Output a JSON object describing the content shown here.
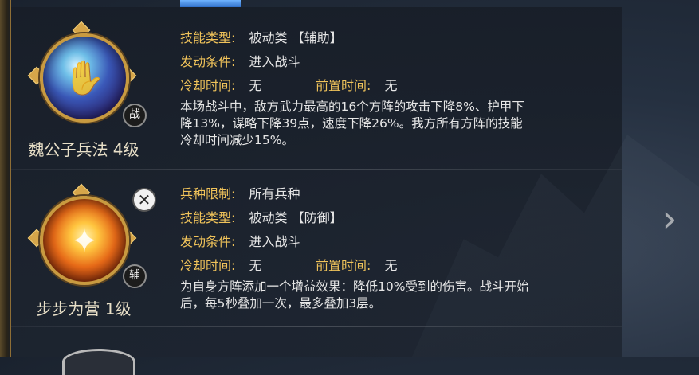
{
  "skills": [
    {
      "name": "魏公子兵法 4级",
      "badge": "战",
      "icon": "blue-spell-orb-icon",
      "rows": [
        {
          "label": "技能类型:",
          "value": "被动类 【辅助】"
        },
        {
          "label": "发动条件:",
          "value": "进入战斗"
        }
      ],
      "cooldown": {
        "label": "冷却时间:",
        "value": "无"
      },
      "prep": {
        "label": "前置时间:",
        "value": "无"
      },
      "description_lines": [
        "本场战斗中，敌方武力最高的16个方阵的攻击下降8%、护甲下",
        "降13%，谋略下降39点，速度下降26%。我方所有方阵的技能",
        "冷却时间减少15%。"
      ]
    },
    {
      "name": "步步为营 1级",
      "badge": "辅",
      "icon": "golden-shield-orb-icon",
      "close_label": "✕",
      "rows": [
        {
          "label": "兵种限制:",
          "value": "所有兵种"
        },
        {
          "label": "技能类型:",
          "value": "被动类 【防御】"
        },
        {
          "label": "发动条件:",
          "value": "进入战斗"
        }
      ],
      "cooldown": {
        "label": "冷却时间:",
        "value": "无"
      },
      "prep": {
        "label": "前置时间:",
        "value": "无"
      },
      "description_lines": [
        "为自身方阵添加一个增益效果：降低10%受到的伤害。战斗开始",
        "后，每5秒叠加一次，最多叠加3层。"
      ]
    }
  ],
  "nav": {
    "next_arrow": "›"
  },
  "colors": {
    "label": "#f0c35a",
    "text": "#e6e6e6",
    "frame_gold": "#c89a40"
  }
}
